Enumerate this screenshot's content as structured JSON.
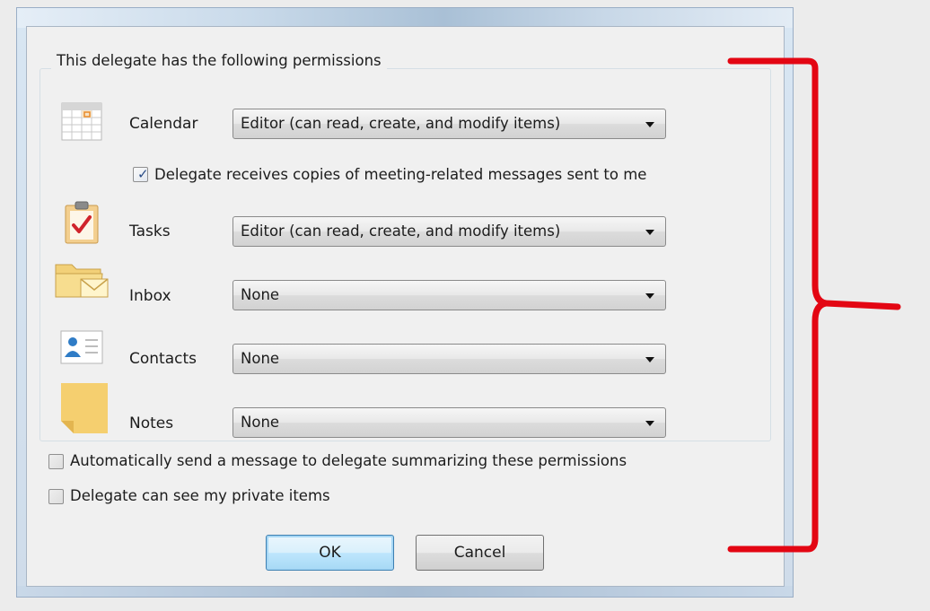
{
  "dialog": {
    "group_title": "This delegate has the following permissions",
    "permissions": [
      {
        "name": "Calendar",
        "icon": "calendar-icon",
        "value": "Editor (can read, create, and modify items)"
      },
      {
        "name": "Tasks",
        "icon": "tasks-clipboard-icon",
        "value": "Editor (can read, create, and modify items)"
      },
      {
        "name": "Inbox",
        "icon": "inbox-folder-icon",
        "value": "None"
      },
      {
        "name": "Contacts",
        "icon": "contacts-card-icon",
        "value": "None"
      },
      {
        "name": "Notes",
        "icon": "sticky-note-icon",
        "value": "None"
      }
    ],
    "meeting_copies": {
      "label": "Delegate receives copies of meeting-related messages sent to me",
      "checked": true
    },
    "auto_send": {
      "label": "Automatically send a message to delegate summarizing these permissions",
      "checked": false
    },
    "private_items": {
      "label": "Delegate can see my private items",
      "checked": false
    },
    "ok_label": "OK",
    "cancel_label": "Cancel"
  },
  "annotation": {
    "type": "curly-brace",
    "color": "#e30613"
  }
}
